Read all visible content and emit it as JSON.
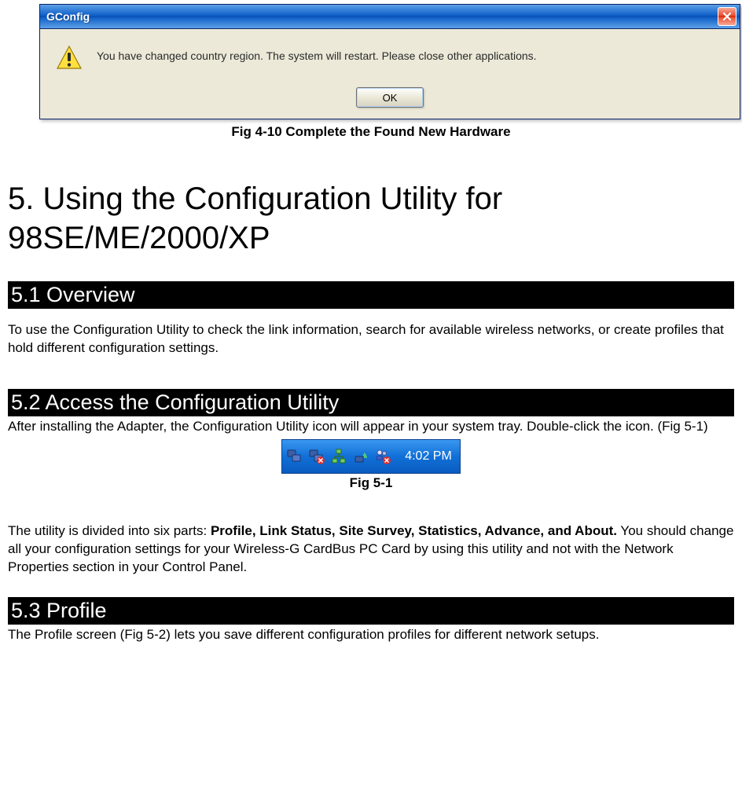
{
  "dialog": {
    "title": "GConfig",
    "message": "You have changed country region. The system will restart. Please close other applications.",
    "ok_label": "OK"
  },
  "fig410_caption": "Fig 4-10 Complete the Found New Hardware",
  "chapter_title": "5. Using the Configuration Utility for 98SE/ME/2000/XP",
  "section51": {
    "title": "5.1 Overview",
    "text": "To use the Configuration Utility to check the link information, search for available wireless networks, or create profiles that hold different configuration settings."
  },
  "section52": {
    "title": "5.2 Access the Configuration Utility",
    "text": "After installing the Adapter, the Configuration Utility icon will appear in your system tray. Double-click the icon. (Fig 5-1)",
    "tray_time": "4:02 PM",
    "fig_caption": "Fig 5-1",
    "parts_intro": "The utility is divided into six parts: ",
    "parts_bold": "Profile, Link Status, Site Survey, Statistics, Advance, and About.",
    "parts_rest": " You should change all your configuration settings for your Wireless-G CardBus PC Card by using this utility and not with the Network Properties section in your Control Panel."
  },
  "section53": {
    "title": "5.3 Profile",
    "text": "The Profile screen (Fig 5-2) lets you save different configuration profiles for different network setups."
  }
}
